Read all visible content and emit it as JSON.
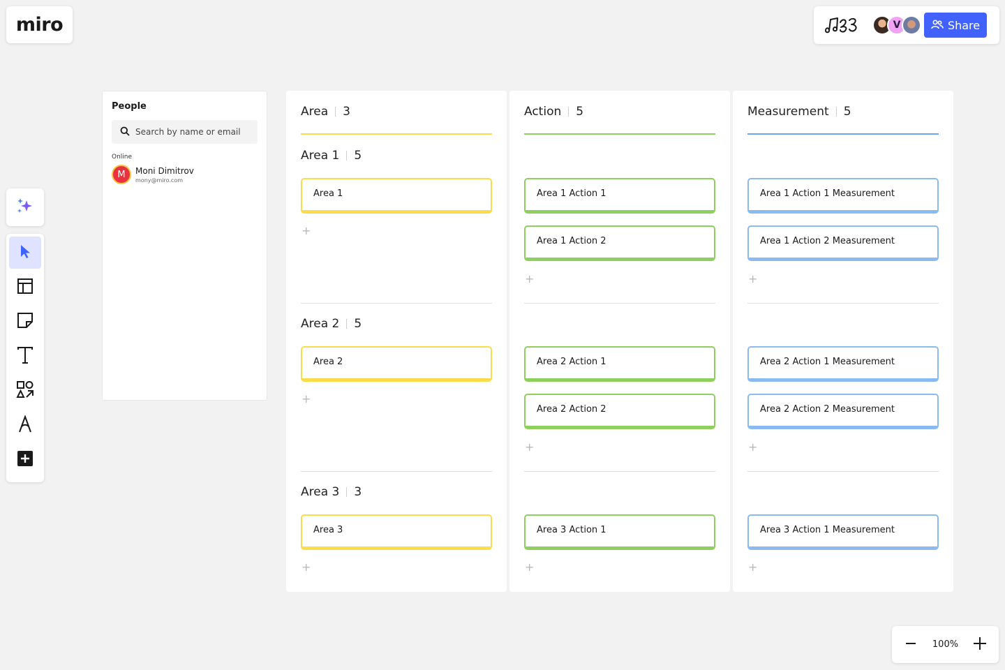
{
  "app": {
    "logo": "miro"
  },
  "topbar": {
    "share_label": "Share",
    "avatar_initial": "V"
  },
  "people_panel": {
    "title": "People",
    "search_placeholder": "Search by name or email",
    "online_label": "Online",
    "user": {
      "initial": "M",
      "name": "Moni Dimitrov",
      "email": "mony@miro.com"
    }
  },
  "columns": [
    {
      "title": "Area",
      "count": "3",
      "color": "#fbdc4a"
    },
    {
      "title": "Action",
      "count": "5",
      "color": "#8fcf5e"
    },
    {
      "title": "Measurement",
      "count": "5",
      "color": "#8bbaf3"
    }
  ],
  "rows": [
    {
      "title": "Area 1",
      "count": "5",
      "areas": [
        "Area 1"
      ],
      "actions": [
        "Area 1 Action 1",
        "Area 1 Action 2"
      ],
      "measurements": [
        "Area 1 Action 1 Measurement",
        "Area 1 Action 2 Measurement"
      ]
    },
    {
      "title": "Area 2",
      "count": "5",
      "areas": [
        "Area 2"
      ],
      "actions": [
        "Area 2 Action 1",
        "Area 2 Action 2"
      ],
      "measurements": [
        "Area 2 Action 1 Measurement",
        "Area 2 Action 2 Measurement"
      ]
    },
    {
      "title": "Area 3",
      "count": "3",
      "areas": [
        "Area 3"
      ],
      "actions": [
        "Area 3 Action 1"
      ],
      "measurements": [
        "Area 3 Action 1 Measurement"
      ]
    }
  ],
  "add_symbol": "+",
  "zoom": {
    "level": "100%"
  },
  "toolbar": {
    "tools": [
      "ai-sparkle-icon",
      "select-cursor-icon",
      "templates-icon",
      "sticky-note-icon",
      "text-icon",
      "shapes-icon",
      "pen-icon",
      "more-tools-icon"
    ]
  }
}
